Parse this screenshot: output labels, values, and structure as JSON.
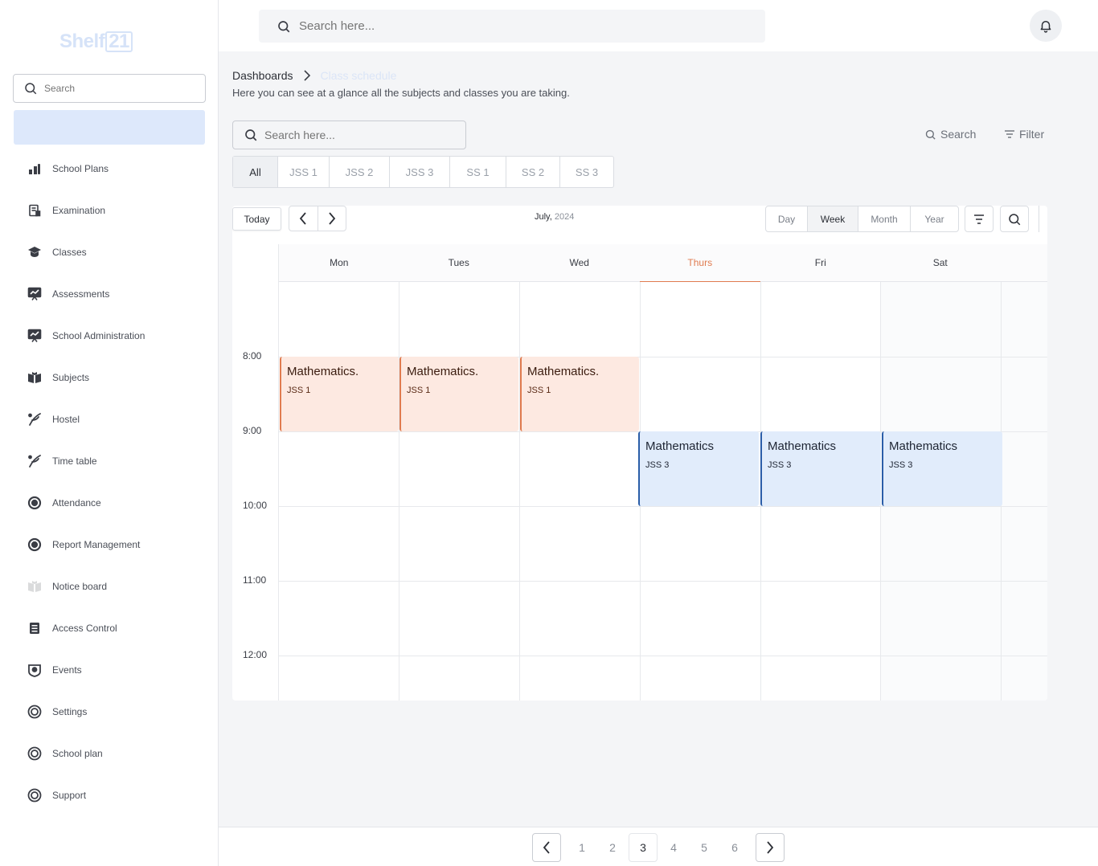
{
  "sidebar": {
    "logo_text": "Shelf",
    "logo_box": "21",
    "search_placeholder": "Search",
    "items": [
      {
        "label": "School Plans",
        "icon": "bar-chart-icon"
      },
      {
        "label": "Examination",
        "icon": "document-icon"
      },
      {
        "label": "Classes",
        "icon": "graduation-cap-icon"
      },
      {
        "label": "Assessments",
        "icon": "presentation-chart-icon"
      },
      {
        "label": "School Administration",
        "icon": "presentation-chart-icon"
      },
      {
        "label": "Subjects",
        "icon": "open-book-icon"
      },
      {
        "label": "Hostel",
        "icon": "feather-icon"
      },
      {
        "label": "Time table",
        "icon": "feather-icon"
      },
      {
        "label": "Attendance",
        "icon": "lifebuoy-icon"
      },
      {
        "label": "Report Management",
        "icon": "lifebuoy-icon"
      },
      {
        "label": "Notice board",
        "icon": "open-book-icon"
      },
      {
        "label": "Access Control",
        "icon": "list-document-icon"
      },
      {
        "label": "Events",
        "icon": "badge-icon"
      },
      {
        "label": "Settings",
        "icon": "settings-ring-icon"
      },
      {
        "label": "School plan",
        "icon": "settings-ring-icon"
      },
      {
        "label": "Support",
        "icon": "settings-ring-icon"
      }
    ]
  },
  "topbar": {
    "search_placeholder": "Search here..."
  },
  "header": {
    "breadcrumb_root": "Dashboards",
    "breadcrumb_current": "Class schedule",
    "subtitle": "Here you can see at a glance all the subjects and classes you are taking."
  },
  "toolbar": {
    "search_placeholder": "Search here...",
    "search_label": "Search",
    "filter_label": "Filter"
  },
  "class_tabs": [
    "All",
    "JSS 1",
    "JSS 2",
    "JSS 3",
    "SS 1",
    "SS 2",
    "SS 3"
  ],
  "calendar": {
    "today_label": "Today",
    "month": "July,",
    "year": "2024",
    "views": [
      "Day",
      "Week",
      "Month",
      "Year"
    ],
    "active_view": "Week",
    "days": [
      "Mon",
      "Tues",
      "Wed",
      "Thurs",
      "Fri",
      "Sat"
    ],
    "today_day": "Thurs",
    "times": [
      "8:00",
      "9:00",
      "10:00",
      "11:00",
      "12:00"
    ],
    "events": [
      {
        "title": "Mathematics.",
        "class": "JSS 1",
        "day": "Mon",
        "start": "8:00",
        "end": "9:00",
        "color": "orange"
      },
      {
        "title": "Mathematics.",
        "class": "JSS 1",
        "day": "Tues",
        "start": "8:00",
        "end": "9:00",
        "color": "orange"
      },
      {
        "title": "Mathematics.",
        "class": "JSS 1",
        "day": "Wed",
        "start": "8:00",
        "end": "9:00",
        "color": "orange"
      },
      {
        "title": "Mathematics",
        "class": "JSS 3",
        "day": "Thurs",
        "start": "9:00",
        "end": "10:00",
        "color": "blue"
      },
      {
        "title": "Mathematics",
        "class": "JSS 3",
        "day": "Fri",
        "start": "9:00",
        "end": "10:00",
        "color": "blue"
      },
      {
        "title": "Mathematics",
        "class": "JSS 3",
        "day": "Sat",
        "start": "9:00",
        "end": "10:00",
        "color": "blue"
      }
    ]
  },
  "pagination": {
    "pages": [
      "1",
      "2",
      "3",
      "4",
      "5",
      "6"
    ],
    "current": "3"
  },
  "colors": {
    "accent_orange": "#e07b4f",
    "accent_blue": "#2b5ea8",
    "event_orange_bg": "#fde9e1",
    "event_blue_bg": "#e1ecfb"
  }
}
